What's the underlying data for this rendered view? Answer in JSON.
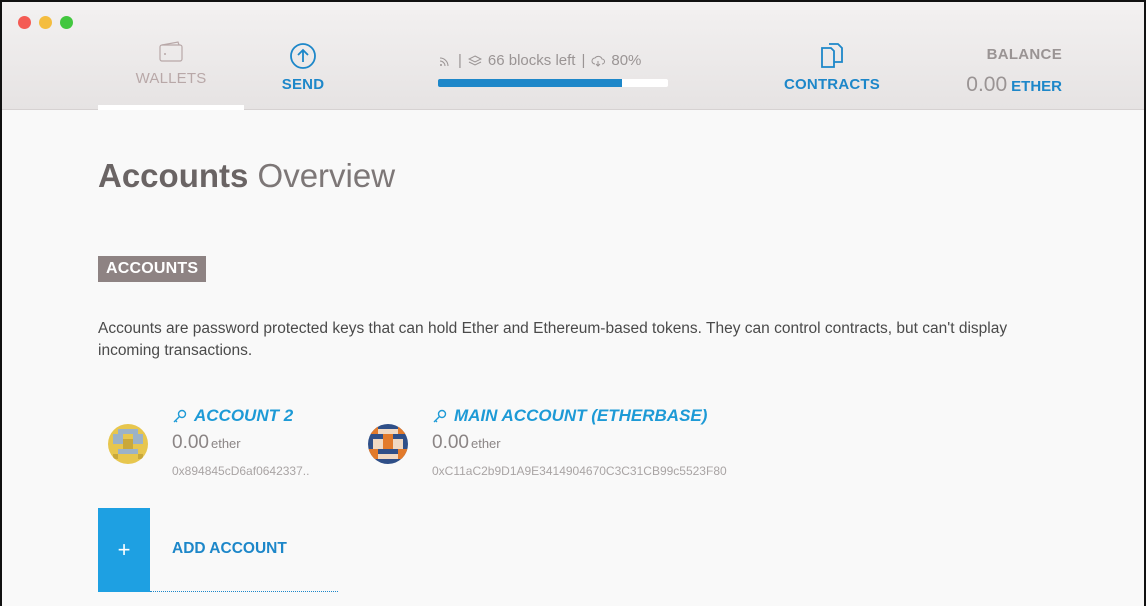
{
  "window": {
    "controls": [
      "close",
      "minimize",
      "zoom"
    ]
  },
  "nav": {
    "wallets": {
      "label": "WALLETS",
      "icon": "wallet-icon"
    },
    "send": {
      "label": "SEND",
      "icon": "arrow-up-circle-icon"
    },
    "contracts": {
      "label": "CONTRACTS",
      "icon": "documents-icon"
    }
  },
  "sync": {
    "peers_icon": "signal-icon",
    "blocks_text": "66 blocks left",
    "separator": "|",
    "progress_text": "80%",
    "progress_fraction": 0.8
  },
  "balance": {
    "label": "BALANCE",
    "value": "0.00",
    "unit": "ETHER"
  },
  "page": {
    "title_bold": "Accounts",
    "title_light": "Overview"
  },
  "accounts_section": {
    "tag": "ACCOUNTS",
    "description": "Accounts are password protected keys that can hold Ether and Ethereum-based tokens. They can control contracts, but can't display incoming transactions."
  },
  "accounts": [
    {
      "name": "ACCOUNT 2",
      "balance": "0.00",
      "unit": "ether",
      "address": "0x894845cD6af0642337.."
    },
    {
      "name": "MAIN ACCOUNT (ETHERBASE)",
      "balance": "0.00",
      "unit": "ether",
      "address": "0xC11aC2b9D1A9E3414904670C3C31CB99c5523F80"
    }
  ],
  "add_account": {
    "icon": "+",
    "label": "ADD ACCOUNT"
  },
  "colors": {
    "accent": "#1d87c9",
    "tag_bg": "#8e8383",
    "add_box": "#1ea0e2"
  }
}
